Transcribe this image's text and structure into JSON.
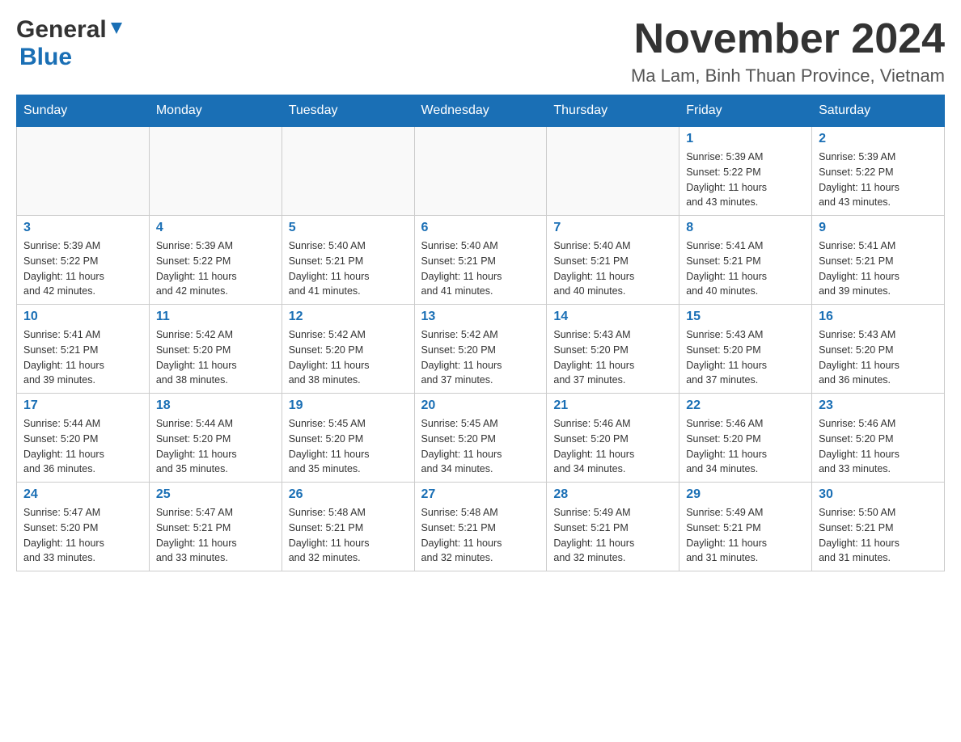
{
  "header": {
    "logo_general": "General",
    "logo_blue": "Blue",
    "title": "November 2024",
    "subtitle": "Ma Lam, Binh Thuan Province, Vietnam"
  },
  "weekdays": [
    "Sunday",
    "Monday",
    "Tuesday",
    "Wednesday",
    "Thursday",
    "Friday",
    "Saturday"
  ],
  "weeks": [
    [
      {
        "day": "",
        "info": ""
      },
      {
        "day": "",
        "info": ""
      },
      {
        "day": "",
        "info": ""
      },
      {
        "day": "",
        "info": ""
      },
      {
        "day": "",
        "info": ""
      },
      {
        "day": "1",
        "info": "Sunrise: 5:39 AM\nSunset: 5:22 PM\nDaylight: 11 hours\nand 43 minutes."
      },
      {
        "day": "2",
        "info": "Sunrise: 5:39 AM\nSunset: 5:22 PM\nDaylight: 11 hours\nand 43 minutes."
      }
    ],
    [
      {
        "day": "3",
        "info": "Sunrise: 5:39 AM\nSunset: 5:22 PM\nDaylight: 11 hours\nand 42 minutes."
      },
      {
        "day": "4",
        "info": "Sunrise: 5:39 AM\nSunset: 5:22 PM\nDaylight: 11 hours\nand 42 minutes."
      },
      {
        "day": "5",
        "info": "Sunrise: 5:40 AM\nSunset: 5:21 PM\nDaylight: 11 hours\nand 41 minutes."
      },
      {
        "day": "6",
        "info": "Sunrise: 5:40 AM\nSunset: 5:21 PM\nDaylight: 11 hours\nand 41 minutes."
      },
      {
        "day": "7",
        "info": "Sunrise: 5:40 AM\nSunset: 5:21 PM\nDaylight: 11 hours\nand 40 minutes."
      },
      {
        "day": "8",
        "info": "Sunrise: 5:41 AM\nSunset: 5:21 PM\nDaylight: 11 hours\nand 40 minutes."
      },
      {
        "day": "9",
        "info": "Sunrise: 5:41 AM\nSunset: 5:21 PM\nDaylight: 11 hours\nand 39 minutes."
      }
    ],
    [
      {
        "day": "10",
        "info": "Sunrise: 5:41 AM\nSunset: 5:21 PM\nDaylight: 11 hours\nand 39 minutes."
      },
      {
        "day": "11",
        "info": "Sunrise: 5:42 AM\nSunset: 5:20 PM\nDaylight: 11 hours\nand 38 minutes."
      },
      {
        "day": "12",
        "info": "Sunrise: 5:42 AM\nSunset: 5:20 PM\nDaylight: 11 hours\nand 38 minutes."
      },
      {
        "day": "13",
        "info": "Sunrise: 5:42 AM\nSunset: 5:20 PM\nDaylight: 11 hours\nand 37 minutes."
      },
      {
        "day": "14",
        "info": "Sunrise: 5:43 AM\nSunset: 5:20 PM\nDaylight: 11 hours\nand 37 minutes."
      },
      {
        "day": "15",
        "info": "Sunrise: 5:43 AM\nSunset: 5:20 PM\nDaylight: 11 hours\nand 37 minutes."
      },
      {
        "day": "16",
        "info": "Sunrise: 5:43 AM\nSunset: 5:20 PM\nDaylight: 11 hours\nand 36 minutes."
      }
    ],
    [
      {
        "day": "17",
        "info": "Sunrise: 5:44 AM\nSunset: 5:20 PM\nDaylight: 11 hours\nand 36 minutes."
      },
      {
        "day": "18",
        "info": "Sunrise: 5:44 AM\nSunset: 5:20 PM\nDaylight: 11 hours\nand 35 minutes."
      },
      {
        "day": "19",
        "info": "Sunrise: 5:45 AM\nSunset: 5:20 PM\nDaylight: 11 hours\nand 35 minutes."
      },
      {
        "day": "20",
        "info": "Sunrise: 5:45 AM\nSunset: 5:20 PM\nDaylight: 11 hours\nand 34 minutes."
      },
      {
        "day": "21",
        "info": "Sunrise: 5:46 AM\nSunset: 5:20 PM\nDaylight: 11 hours\nand 34 minutes."
      },
      {
        "day": "22",
        "info": "Sunrise: 5:46 AM\nSunset: 5:20 PM\nDaylight: 11 hours\nand 34 minutes."
      },
      {
        "day": "23",
        "info": "Sunrise: 5:46 AM\nSunset: 5:20 PM\nDaylight: 11 hours\nand 33 minutes."
      }
    ],
    [
      {
        "day": "24",
        "info": "Sunrise: 5:47 AM\nSunset: 5:20 PM\nDaylight: 11 hours\nand 33 minutes."
      },
      {
        "day": "25",
        "info": "Sunrise: 5:47 AM\nSunset: 5:21 PM\nDaylight: 11 hours\nand 33 minutes."
      },
      {
        "day": "26",
        "info": "Sunrise: 5:48 AM\nSunset: 5:21 PM\nDaylight: 11 hours\nand 32 minutes."
      },
      {
        "day": "27",
        "info": "Sunrise: 5:48 AM\nSunset: 5:21 PM\nDaylight: 11 hours\nand 32 minutes."
      },
      {
        "day": "28",
        "info": "Sunrise: 5:49 AM\nSunset: 5:21 PM\nDaylight: 11 hours\nand 32 minutes."
      },
      {
        "day": "29",
        "info": "Sunrise: 5:49 AM\nSunset: 5:21 PM\nDaylight: 11 hours\nand 31 minutes."
      },
      {
        "day": "30",
        "info": "Sunrise: 5:50 AM\nSunset: 5:21 PM\nDaylight: 11 hours\nand 31 minutes."
      }
    ]
  ]
}
